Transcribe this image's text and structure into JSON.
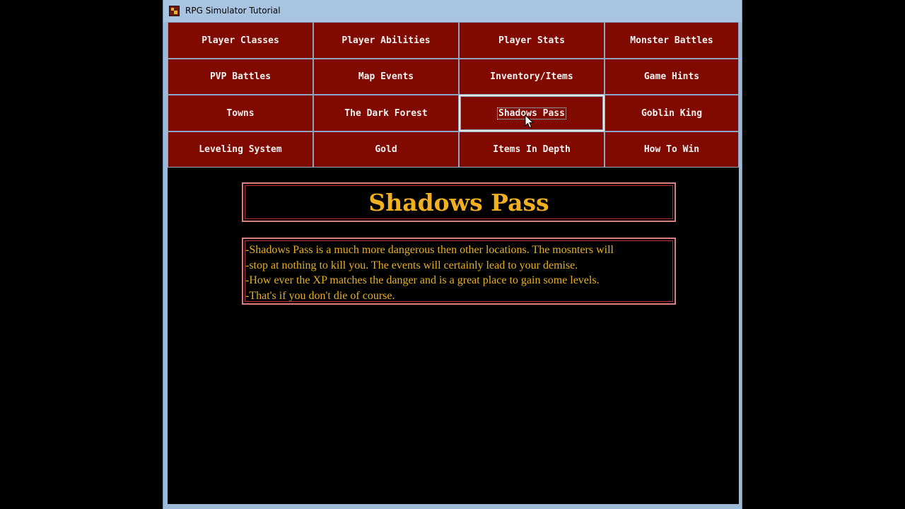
{
  "window": {
    "title": "RPG Simulator Tutorial",
    "app_icon": "rpg-game-icon"
  },
  "nav": {
    "rows": [
      [
        "Player Classes",
        "Player Abilities",
        "Player Stats",
        "Monster Battles"
      ],
      [
        "PVP Battles",
        "Map Events",
        "Inventory/Items",
        "Game Hints"
      ],
      [
        "Towns",
        "The Dark Forest",
        "Shadows Pass",
        "Goblin King"
      ],
      [
        "Leveling System",
        "Gold",
        "Items In Depth",
        "How To Win"
      ]
    ],
    "active": "Shadows Pass"
  },
  "content": {
    "heading": "Shadows Pass",
    "lines": [
      "-Shadows Pass is a much more dangerous then other locations. The mosnters will",
      "-stop at nothing to kill you. The events will certainly lead to your demise.",
      "-How ever the XP matches the danger and is a great place to gain some levels.",
      "-That's if you don't die of course."
    ]
  },
  "colors": {
    "button_bg": "#800a00",
    "heading_text": "#f0b020",
    "body_text": "#e6b020",
    "box_border": "#d88080",
    "window_frame": "#9cb9d8"
  }
}
